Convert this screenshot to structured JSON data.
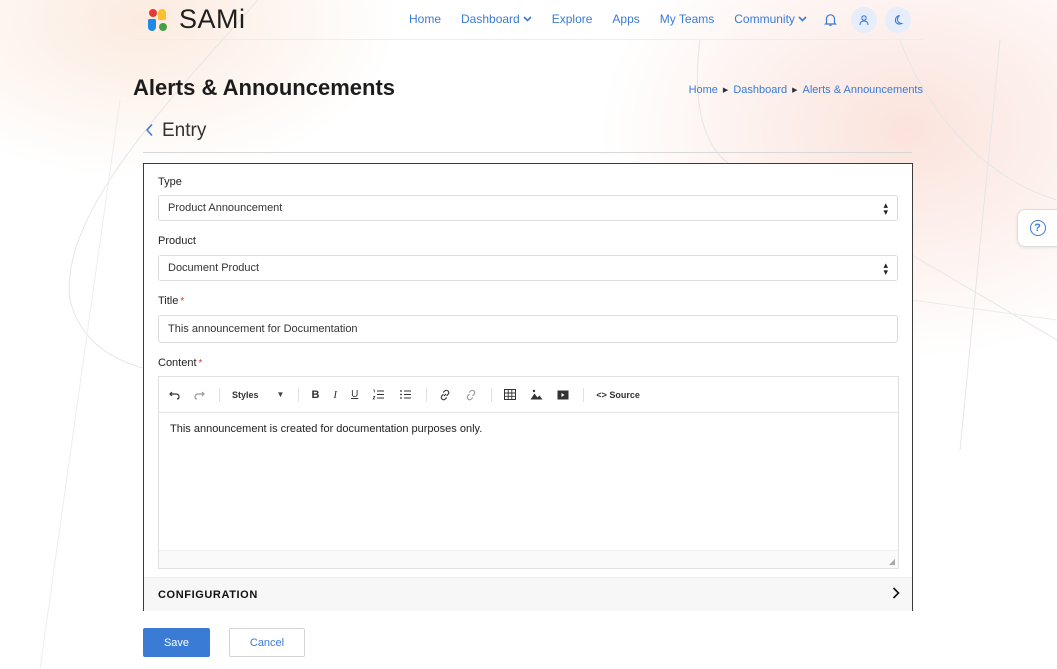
{
  "brand": {
    "name": "SAMi"
  },
  "nav": {
    "links": [
      {
        "label": "Home",
        "dropdown": false
      },
      {
        "label": "Dashboard",
        "dropdown": true
      },
      {
        "label": "Explore",
        "dropdown": false
      },
      {
        "label": "Apps",
        "dropdown": false
      },
      {
        "label": "My Teams",
        "dropdown": false
      },
      {
        "label": "Community",
        "dropdown": true
      }
    ],
    "icons": [
      "bell-icon",
      "user-icon",
      "moon-icon"
    ]
  },
  "page": {
    "title": "Alerts & Announcements",
    "breadcrumb": [
      "Home",
      "Dashboard",
      "Alerts & Announcements"
    ]
  },
  "entry": {
    "heading": "Entry"
  },
  "form": {
    "type": {
      "label": "Type",
      "value": "Product Announcement"
    },
    "product": {
      "label": "Product",
      "value": "Document Product"
    },
    "title": {
      "label": "Title",
      "value": "This announcement for Documentation",
      "required": true
    },
    "content": {
      "label": "Content",
      "required": true,
      "toolbar": {
        "styles_label": "Styles",
        "source_label": "Source"
      },
      "body": "This announcement is created for documentation purposes only."
    },
    "configuration": {
      "label": "CONFIGURATION"
    }
  },
  "actions": {
    "save_label": "Save",
    "cancel_label": "Cancel"
  },
  "colors": {
    "accent": "#3a7bd5",
    "required": "#e53935"
  }
}
